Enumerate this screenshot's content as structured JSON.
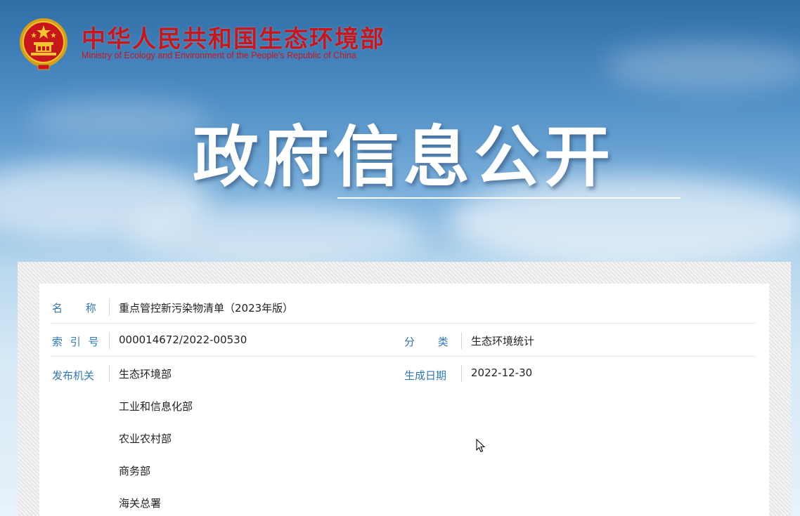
{
  "header": {
    "brand_cn": "中华人民共和国生态环境部",
    "brand_en": "Ministry of Ecology and Environment of the People's Republic of China",
    "hero_title": "政府信息公开",
    "brand_color": "#c8161d"
  },
  "record": {
    "name_label": "名    称",
    "name_value": "重点管控新污染物清单（2023年版）",
    "index_label": "索 引 号",
    "index_value": "000014672/2022-00530",
    "category_label": "分    类",
    "category_value": "生态环境统计",
    "publisher_label": "发布机关",
    "publishers": [
      "生态环境部",
      "工业和信息化部",
      "农业农村部",
      "商务部",
      "海关总署"
    ],
    "date_label": "生成日期",
    "date_value": "2022-12-30",
    "label_color": "#2f79b7"
  }
}
